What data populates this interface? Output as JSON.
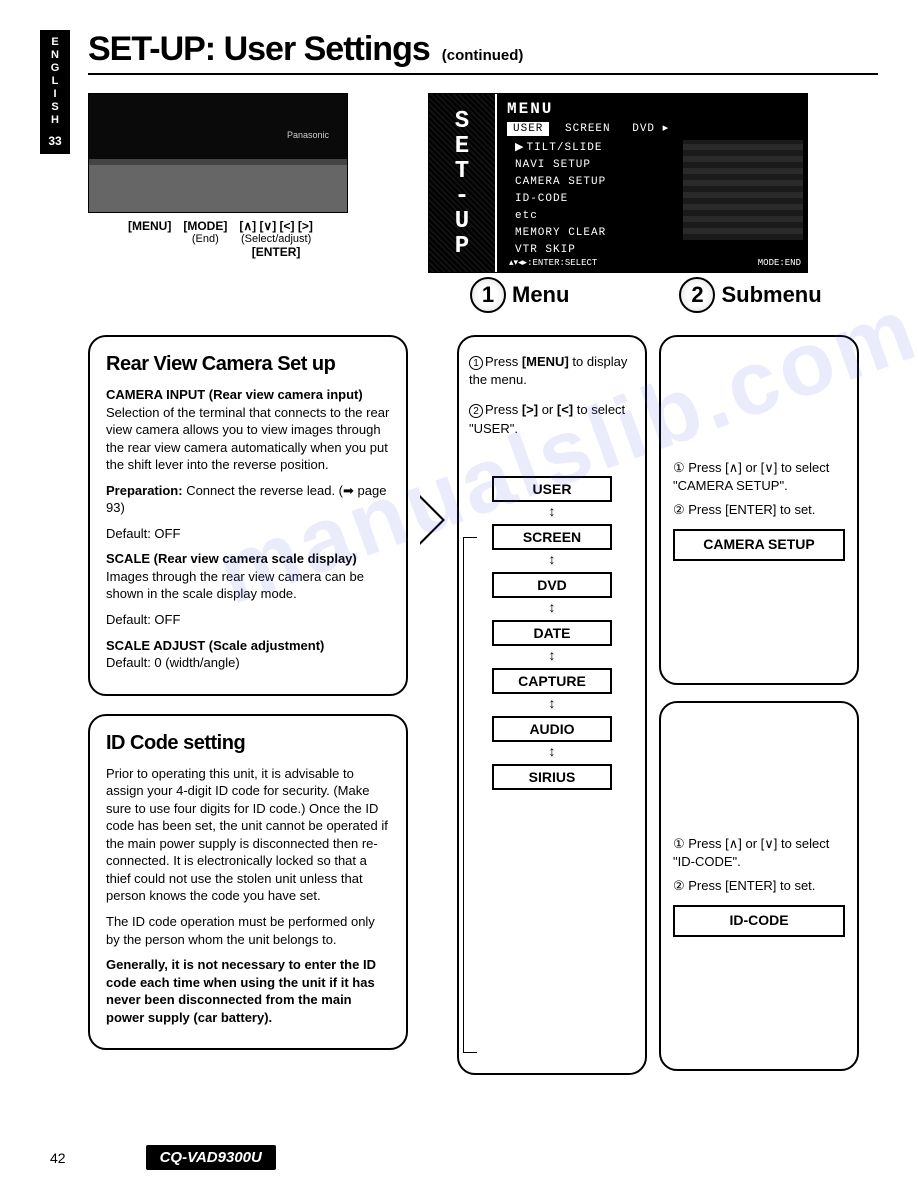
{
  "lang_tab": {
    "letters": "ENGLISH",
    "page_side": "33"
  },
  "title": "SET-UP: User Settings",
  "continued": "(continued)",
  "device": {
    "brand": "Panasonic",
    "labels": {
      "menu": "[MENU]",
      "mode": "[MODE]",
      "mode_sub": "(End)",
      "arrows": "[∧] [∨] [<] [>]",
      "arrows_sub": "(Select/adjust)",
      "enter": "[ENTER]"
    }
  },
  "screen": {
    "side": "SET-UP",
    "menu_label": "MENU",
    "tabs": [
      "USER",
      "SCREEN",
      "DVD ▸"
    ],
    "items": [
      "TILT/SLIDE",
      "NAVI SETUP",
      "CAMERA SETUP",
      "ID-CODE",
      "etc",
      "MEMORY CLEAR",
      "VTR SKIP"
    ],
    "footer_left": "▴▾◂▸:ENTER:SELECT",
    "footer_right": "MODE:END"
  },
  "step1_label": "Menu",
  "step2_label": "Submenu",
  "rear_view": {
    "title": "Rear View Camera Set up",
    "h1": "CAMERA INPUT (Rear view camera input)",
    "p1": "Selection of the terminal that connects to the rear view camera allows you to view images through the rear view camera automatically when you put the shift lever into the reverse position.",
    "prep_label": "Preparation:",
    "prep": " Connect the reverse lead. (➡ page 93)",
    "default1": "Default: OFF",
    "h2": "SCALE (Rear view camera scale display)",
    "p2": "Images through the rear view camera can be shown in the scale display mode.",
    "default2": "Default: OFF",
    "h3": "SCALE ADJUST (Scale adjustment)",
    "default3": "Default: 0 (width/angle)"
  },
  "id_code": {
    "title": "ID Code setting",
    "p1": "Prior to operating this unit, it is advisable to assign your 4-digit ID code for security. (Make sure to use four digits for ID code.) Once the ID code has been set, the unit cannot be operated if the main power supply is disconnected then re-connected. It is electronically locked so that a thief could not use the stolen unit unless that person knows the code you have set.",
    "p2": "The ID code operation must be performed only by the person whom the unit belongs to.",
    "p3": "Generally, it is not necessary to enter the ID code each time when using the unit if it has never been disconnected from the main power supply (car battery)."
  },
  "menu_flow": {
    "instr1_a": "Press ",
    "instr1_b": "[MENU]",
    "instr1_c": " to display the menu.",
    "instr2_a": "Press ",
    "instr2_b": "[>]",
    "instr2_c": " or ",
    "instr2_d": "[<]",
    "instr2_e": " to select \"USER\".",
    "items": [
      "USER",
      "SCREEN",
      "DVD",
      "DATE",
      "CAPTURE",
      "AUDIO",
      "SIRIUS"
    ]
  },
  "sub_camera": {
    "instr1": "① Press [∧] or [∨] to select \"CAMERA SETUP\".",
    "instr2": "② Press [ENTER] to set.",
    "btn": "CAMERA SETUP"
  },
  "sub_idcode": {
    "instr1": "① Press [∧] or [∨] to select \"ID-CODE\".",
    "instr2": "② Press [ENTER] to set.",
    "btn": "ID-CODE"
  },
  "footer": {
    "page": "42",
    "model": "CQ-VAD9300U"
  },
  "watermark": "manualslib.com"
}
